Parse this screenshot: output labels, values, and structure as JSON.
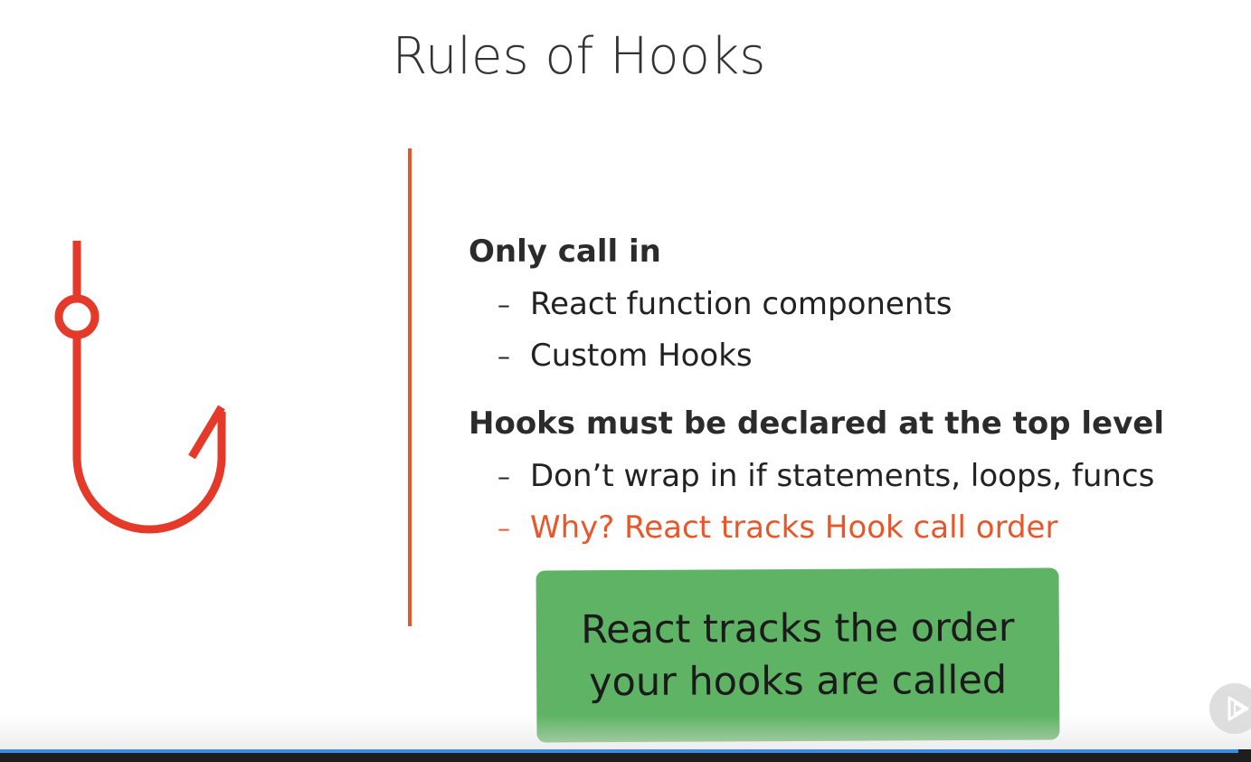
{
  "slide": {
    "title": "Rules of Hooks",
    "sections": [
      {
        "heading": "Only call in",
        "items": [
          {
            "text": "React function components",
            "accent": false
          },
          {
            "text": "Custom Hooks",
            "accent": false
          }
        ]
      },
      {
        "heading": "Hooks must be declared at the top level",
        "items": [
          {
            "text": "Don’t wrap in if statements, loops, funcs",
            "accent": false
          },
          {
            "text": "Why? React tracks Hook call order",
            "accent": true
          }
        ]
      }
    ],
    "callout": {
      "line1": "React tracks the order",
      "line2": "your hooks are called"
    }
  },
  "icons": {
    "illustration": "fish-hook-icon",
    "player_control": "play-icon"
  },
  "colors": {
    "accent": "#e8562a",
    "hook": "#e53a2a",
    "callout_bg": "#5fb364",
    "progress": "#3b8be0"
  },
  "player": {
    "progress": 0.99
  },
  "list_marker": "–"
}
